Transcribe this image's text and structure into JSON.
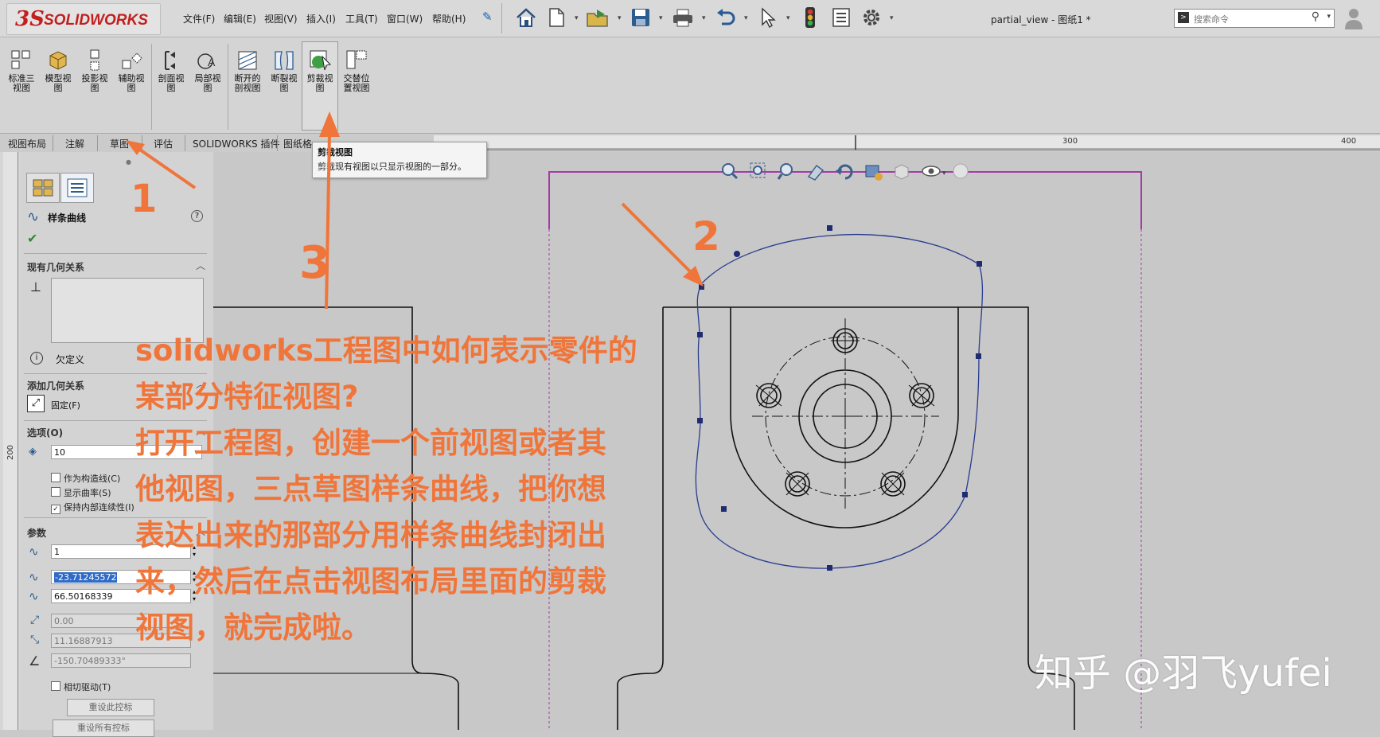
{
  "app": {
    "logo_ds": "3S",
    "logo_text": "SOLIDWORKS"
  },
  "menu": [
    "文件(F)",
    "编辑(E)",
    "视图(V)",
    "插入(I)",
    "工具(T)",
    "窗口(W)",
    "帮助(H)"
  ],
  "document_title": "partial_view - 图纸1 *",
  "search": {
    "placeholder": "搜索命令"
  },
  "toolbar": {
    "tools": [
      {
        "label": "标准三\n视图",
        "icon": "standard-3-view-icon"
      },
      {
        "label": "模型视\n图",
        "icon": "model-view-icon"
      },
      {
        "label": "投影视\n图",
        "icon": "projected-view-icon"
      },
      {
        "label": "辅助视\n图",
        "icon": "auxiliary-view-icon"
      },
      {
        "label": "剖面视\n图",
        "icon": "section-view-icon"
      },
      {
        "label": "局部视\n图",
        "icon": "detail-view-icon"
      },
      {
        "label": "断开的\n剖视图",
        "icon": "broken-out-section-icon"
      },
      {
        "label": "断裂视\n图",
        "icon": "break-view-icon"
      },
      {
        "label": "剪裁视\n图",
        "icon": "crop-view-icon"
      },
      {
        "label": "交替位\n置视图",
        "icon": "alternate-position-view-icon"
      }
    ]
  },
  "tabs": [
    "视图布局",
    "注解",
    "草图",
    "评估",
    "SOLIDWORKS 插件",
    "图纸格"
  ],
  "ruler": {
    "mark_a": "300",
    "mark_b": "400",
    "side_mark": "200"
  },
  "tooltip": {
    "title": "剪裁视图",
    "body": "剪裁现有视图以只显示视图的一部分。"
  },
  "property_manager": {
    "title": "样条曲线",
    "help": "?",
    "existing_relations": "现有几何关系",
    "status": "欠定义",
    "add_relations": "添加几何关系",
    "fix_label": "固定(F)",
    "options": "选项(O)",
    "resolution_value": "10",
    "checkboxes": [
      {
        "label": "作为构造线(C)",
        "checked": false
      },
      {
        "label": "显示曲率(S)",
        "checked": false
      },
      {
        "label": "保持内部连续性(I)",
        "checked": true
      }
    ],
    "parameters": "参数",
    "point_number": "1",
    "x_value": "-23.71245572",
    "y_value": "66.50168339",
    "weight_value": "0.00",
    "radial_value": "11.16887913",
    "angle_value": "-150.70489333°",
    "tangent_driving": "相切驱动(T)",
    "reset_button": "重设此控标",
    "reset_all_button": "重设所有控标"
  },
  "annotation": {
    "lines": [
      "solidworks工程图中如何表示零件的",
      "某部分特征视图?",
      "打开工程图，创建一个前视图或者其",
      "他视图，三点草图样条曲线，把你想",
      "表达出来的那部分用样条曲线封闭出",
      "来，然后在点击视图布局里面的剪裁",
      "视图，就完成啦。"
    ],
    "step1": "1",
    "step2": "2",
    "step3": "3",
    "color": "#f0753a"
  },
  "watermark": "知乎 @羽飞yufei",
  "colors": {
    "spline": "#2a3b8f",
    "sheet_border": "#a63aa8",
    "accent": "#f0753a",
    "logo": "#c21f1f"
  }
}
